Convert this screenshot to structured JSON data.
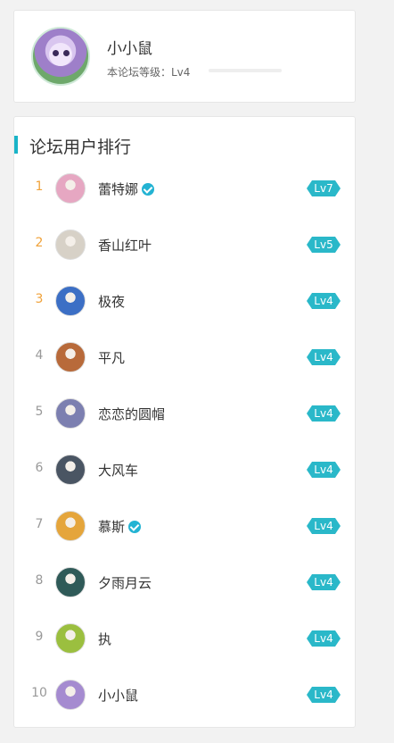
{
  "profile": {
    "name": "小小鼠",
    "level_label": "本论坛等级：Lv4",
    "level_progress": 0
  },
  "ranking": {
    "title": "论坛用户排行",
    "users": [
      {
        "rank": "1",
        "name": "蕾特娜",
        "verified": true,
        "level": "Lv7",
        "avatar_color": "#e6a7c2"
      },
      {
        "rank": "2",
        "name": "香山红叶",
        "verified": false,
        "level": "Lv5",
        "avatar_color": "#d7d1c7"
      },
      {
        "rank": "3",
        "name": "极夜",
        "verified": false,
        "level": "Lv4",
        "avatar_color": "#3c6fc5"
      },
      {
        "rank": "4",
        "name": "平凡",
        "verified": false,
        "level": "Lv4",
        "avatar_color": "#b86a3a"
      },
      {
        "rank": "5",
        "name": "恋恋的圆帽",
        "verified": false,
        "level": "Lv4",
        "avatar_color": "#7c7fb0"
      },
      {
        "rank": "6",
        "name": "大风车",
        "verified": false,
        "level": "Lv4",
        "avatar_color": "#4a5563"
      },
      {
        "rank": "7",
        "name": "慕斯",
        "verified": true,
        "level": "Lv4",
        "avatar_color": "#e5a53b"
      },
      {
        "rank": "8",
        "name": "夕雨月云",
        "verified": false,
        "level": "Lv4",
        "avatar_color": "#2f5a58"
      },
      {
        "rank": "9",
        "name": "执",
        "verified": false,
        "level": "Lv4",
        "avatar_color": "#9bbf3f"
      },
      {
        "rank": "10",
        "name": "小小鼠",
        "verified": false,
        "level": "Lv4",
        "avatar_color": "#a58bd0"
      }
    ]
  }
}
